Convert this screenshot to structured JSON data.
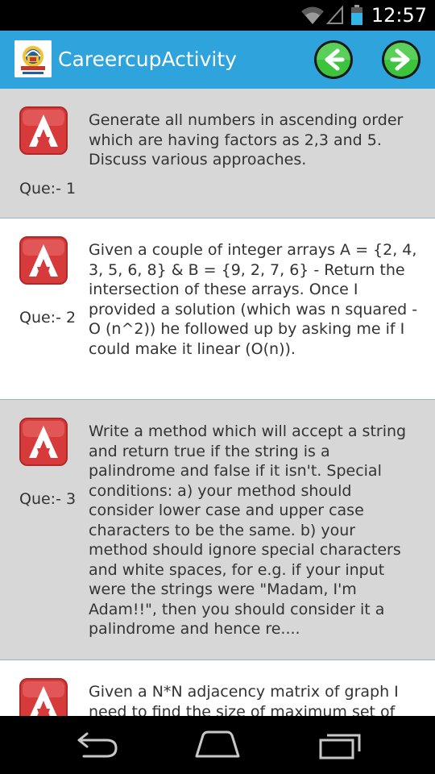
{
  "status_bar": {
    "time": "12:57",
    "icons": [
      "wifi-icon",
      "signal-icon",
      "battery-icon"
    ]
  },
  "action_bar": {
    "title": "CareercupActivity",
    "back_icon": "arrow-left-icon",
    "forward_icon": "arrow-right-icon",
    "colors": {
      "bar": "#2ea3dc",
      "nav_button": "#3cc43c"
    }
  },
  "questions": [
    {
      "label": "Que:- 1",
      "text": "Generate all numbers in ascending order which are having factors as 2,3 and 5. Discuss various approaches."
    },
    {
      "label": "Que:- 2",
      "text": "Given a couple of integer arrays A = {2, 4, 3, 5, 6, 8} & B = {9, 2, 7, 6} - Return the intersection of these arrays. Once I provided a solution (which was n squared - O (n^2)) he followed up by asking me if I could make it linear (O(n))."
    },
    {
      "label": "Que:- 3",
      "text": "Write a method which will accept a string and return true if the string is a palindrome and false if it isn't. Special conditions: a) your method should consider lower case and upper case characters to be the same. b) your method should ignore special characters and white spaces, for e.g. if your input were the strings were \"Madam, I'm Adam!!\", then you should consider it a palindrome and hence re...."
    },
    {
      "label": "",
      "text": "Given a N*N adjacency matrix of graph I need to find the size of maximum set of"
    }
  ],
  "row_colors": {
    "odd": "#d7d7d7",
    "even": "#ffffff",
    "icon": "#d63a3a"
  },
  "system_nav": [
    "back-icon",
    "home-icon",
    "recent-apps-icon"
  ]
}
